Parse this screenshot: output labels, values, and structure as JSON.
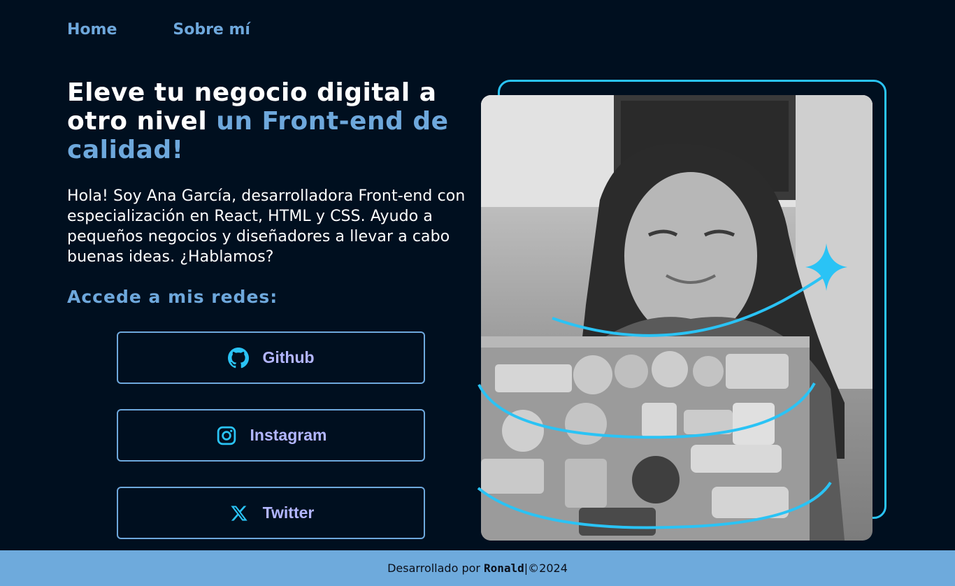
{
  "nav": {
    "home": "Home",
    "about": "Sobre mí"
  },
  "hero": {
    "title_main": "Eleve tu negocio digital a otro nivel",
    "title_accent": "un Front-end de calidad!",
    "intro": "Hola! Soy Ana García, desarrolladora Front-end con especialización en React, HTML y CSS. Ayudo a pequeños negocios y diseñadores a llevar a cabo buenas ideas. ¿Hablamos?"
  },
  "social": {
    "title": "Accede a mis redes:",
    "buttons": [
      {
        "label": "Github",
        "icon": "github-icon"
      },
      {
        "label": "Instagram",
        "icon": "instagram-icon"
      },
      {
        "label": "Twitter",
        "icon": "x-twitter-icon"
      }
    ]
  },
  "footer": {
    "prefix": "Desarrollado por",
    "author": "Ronald",
    "suffix": "|©2024"
  },
  "colors": {
    "background": "#000f1f",
    "accent": "#6ea8dc",
    "button_text": "#b3b6ff",
    "cyan": "#2ac3f5",
    "footer_bg": "#6eaadc"
  }
}
